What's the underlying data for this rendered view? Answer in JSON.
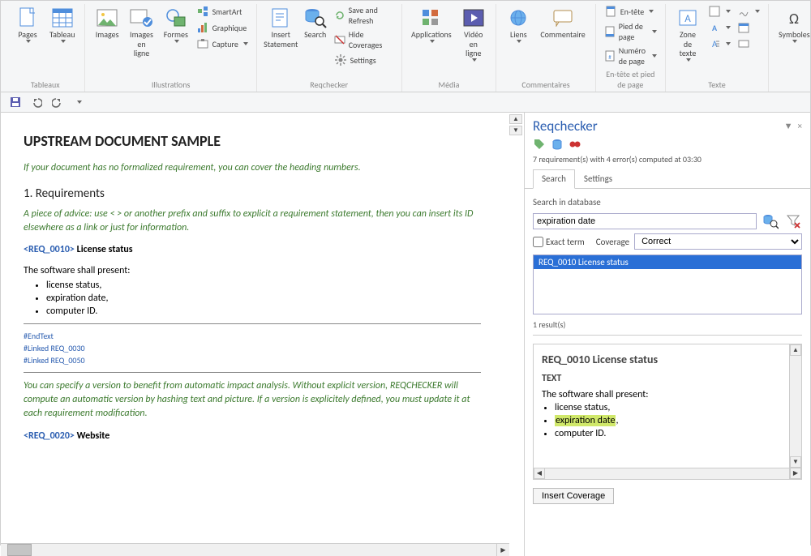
{
  "ribbon": {
    "groups": {
      "tableaux": {
        "caption": "Tableaux",
        "pages": "Pages",
        "tableau": "Tableau"
      },
      "illustrations": {
        "caption": "Illustrations",
        "images": "Images",
        "images_en_ligne": "Images\nen ligne",
        "formes": "Formes",
        "smartart": "SmartArt",
        "graphique": "Graphique",
        "capture": "Capture"
      },
      "reqchecker": {
        "caption": "Reqchecker",
        "insert_statement": "Insert\nStatement",
        "search": "Search",
        "save_refresh": "Save and Refresh",
        "hide_coverages": "Hide Coverages",
        "settings": "Settings"
      },
      "media": {
        "caption": "Média",
        "applications": "Applications",
        "video": "Vidéo\nen ligne"
      },
      "commentaires": {
        "caption": "Commentaires",
        "liens": "Liens",
        "commentaire": "Commentaire"
      },
      "entete": {
        "caption": "En-tête et pied de page",
        "en_tete": "En-tête",
        "pied_de_page": "Pied de page",
        "numero": "Numéro de page"
      },
      "texte": {
        "caption": "Texte",
        "zone": "Zone de\ntexte"
      },
      "symboles": {
        "caption": "",
        "symboles": "Symboles"
      }
    }
  },
  "qat": {
    "save": "save",
    "undo": "undo",
    "redo": "redo"
  },
  "document": {
    "title": "UPSTREAM DOCUMENT SAMPLE",
    "advice1": "If your document has no formalized requirement, you can cover the heading numbers.",
    "h1": "1.  Requirements",
    "advice2": "A piece of advice: use < > or another prefix and suffix to explicit a requirement statement, then you can insert its ID elsewhere as a link or just for information.",
    "req1_tag": "<REQ_0010>",
    "req1_title": " License status",
    "body1": "The software shall present:",
    "bullets": [
      "license status,",
      "expiration date,",
      "computer ID."
    ],
    "meta": [
      "#EndText",
      "#Linked REQ_0030",
      "#Linked REQ_0050"
    ],
    "advice3": "You can specify a version to benefit from automatic impact analysis. Without explicit version, REQCHECKER will compute an automatic version by hashing text and picture. If a version is explicitely defined, you must update it at each requirement modification.",
    "req2_tag": "<REQ_0020>",
    "req2_title": " Website"
  },
  "panel": {
    "title": "Reqchecker",
    "status": "7 requirement(s) with 4 error(s) computed at 03:30",
    "tabs": {
      "search": "Search",
      "settings": "Settings"
    },
    "search_label": "Search in database",
    "search_value": "expiration date",
    "exact_term": "Exact term",
    "coverage_label": "Coverage",
    "coverage_value": "Correct",
    "results": [
      "REQ_0010 License status"
    ],
    "result_count": "1 result(s)",
    "preview": {
      "title": "REQ_0010 License status",
      "heading": "TEXT",
      "body": "The software shall present:",
      "bullets": [
        "license status,",
        "expiration date",
        "computer ID."
      ],
      "highlight": "expiration date"
    },
    "insert_coverage": "Insert Coverage"
  }
}
